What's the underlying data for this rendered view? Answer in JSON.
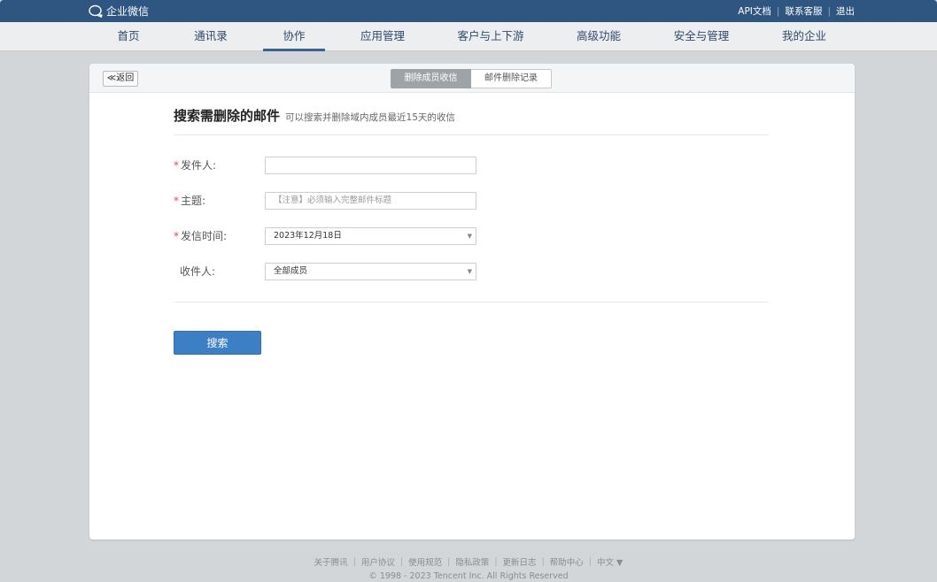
{
  "header": {
    "logo_text": "企业微信",
    "links": [
      "API文档",
      "联系客服",
      "退出"
    ]
  },
  "nav": {
    "items": [
      "首页",
      "通讯录",
      "协作",
      "应用管理",
      "客户与上下游",
      "高级功能",
      "安全与管理",
      "我的企业"
    ],
    "active": "协作"
  },
  "card": {
    "back_label": "≪返回",
    "tabs": [
      {
        "label": "删除成员收信",
        "active": true
      },
      {
        "label": "邮件删除记录",
        "active": false
      }
    ],
    "title": "搜索需删除的邮件",
    "subtitle": "可以搜索并删除域内成员最近15天的收信"
  },
  "form": {
    "sender": {
      "required_mark": "*",
      "label": "发件人:",
      "value": "",
      "placeholder": ""
    },
    "subject": {
      "required_mark": "*",
      "label": "主题:",
      "value": "",
      "placeholder": "【注意】必须输入完整邮件标题"
    },
    "send_time": {
      "required_mark": "*",
      "label": "发信时间:",
      "value": "2023年12月18日"
    },
    "recipient": {
      "label": "收件人:",
      "value": "全部成员"
    },
    "search_label": "搜索"
  },
  "footer": {
    "links": [
      "关于腾讯",
      "用户协议",
      "使用规范",
      "隐私政策",
      "更新日志",
      "帮助中心",
      "中文 ▼"
    ],
    "copyright": "© 1998 - 2023 Tencent Inc. All Rights Reserved"
  },
  "colors": {
    "topbar": "#2f5581",
    "accent": "#3d7fc4",
    "required": "#e04848"
  }
}
